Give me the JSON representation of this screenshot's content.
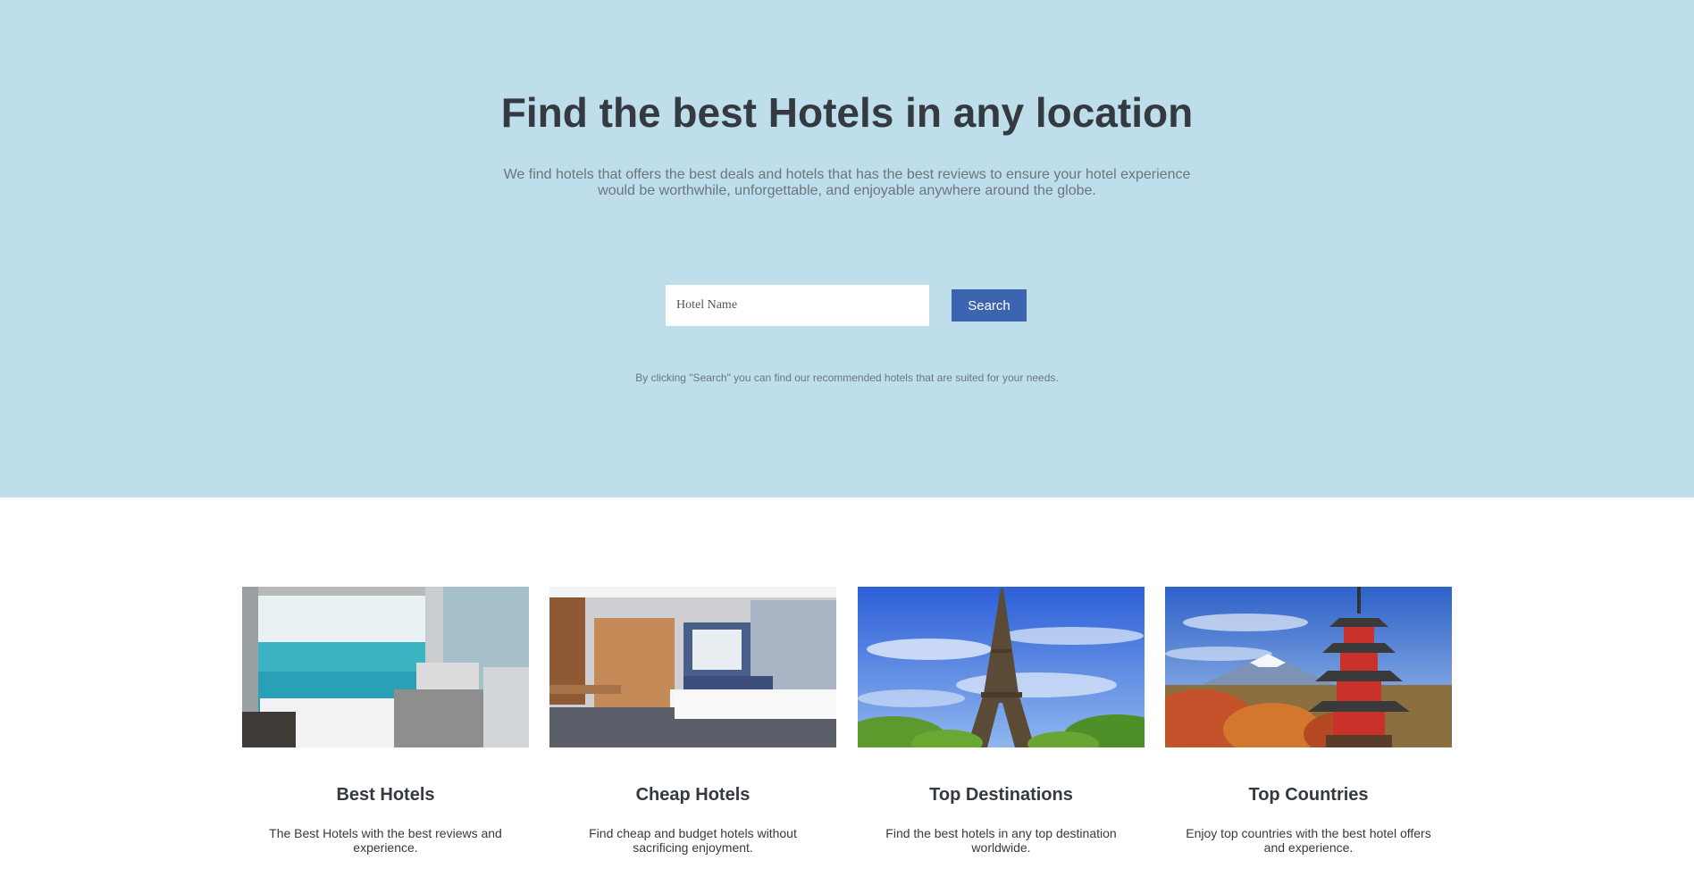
{
  "hero": {
    "title": "Find the best Hotels in any location",
    "subtitle": "We find hotels that offers the best deals and hotels that has the best reviews to ensure your hotel experience would be worthwhile, unforgettable, and enjoyable anywhere around the globe.",
    "search_placeholder": "Hotel Name",
    "search_button": "Search",
    "note": "By clicking \"Search\" you can find our recommended hotels that are suited for your needs.",
    "background": "#bddeea",
    "accent": "#3c64b1"
  },
  "features": [
    {
      "title": "Best Hotels",
      "text": "The Best Hotels with the best reviews and experience.",
      "image": "ocean-view-bedroom"
    },
    {
      "title": "Cheap Hotels",
      "text": "Find cheap and budget hotels without sacrificing enjoyment.",
      "image": "hotel-room"
    },
    {
      "title": "Top Destinations",
      "text": "Find the best hotels in any top destination worldwide.",
      "image": "eiffel-tower"
    },
    {
      "title": "Top Countries",
      "text": "Enjoy top countries with the best hotel offers and experience.",
      "image": "japan-pagoda"
    }
  ]
}
